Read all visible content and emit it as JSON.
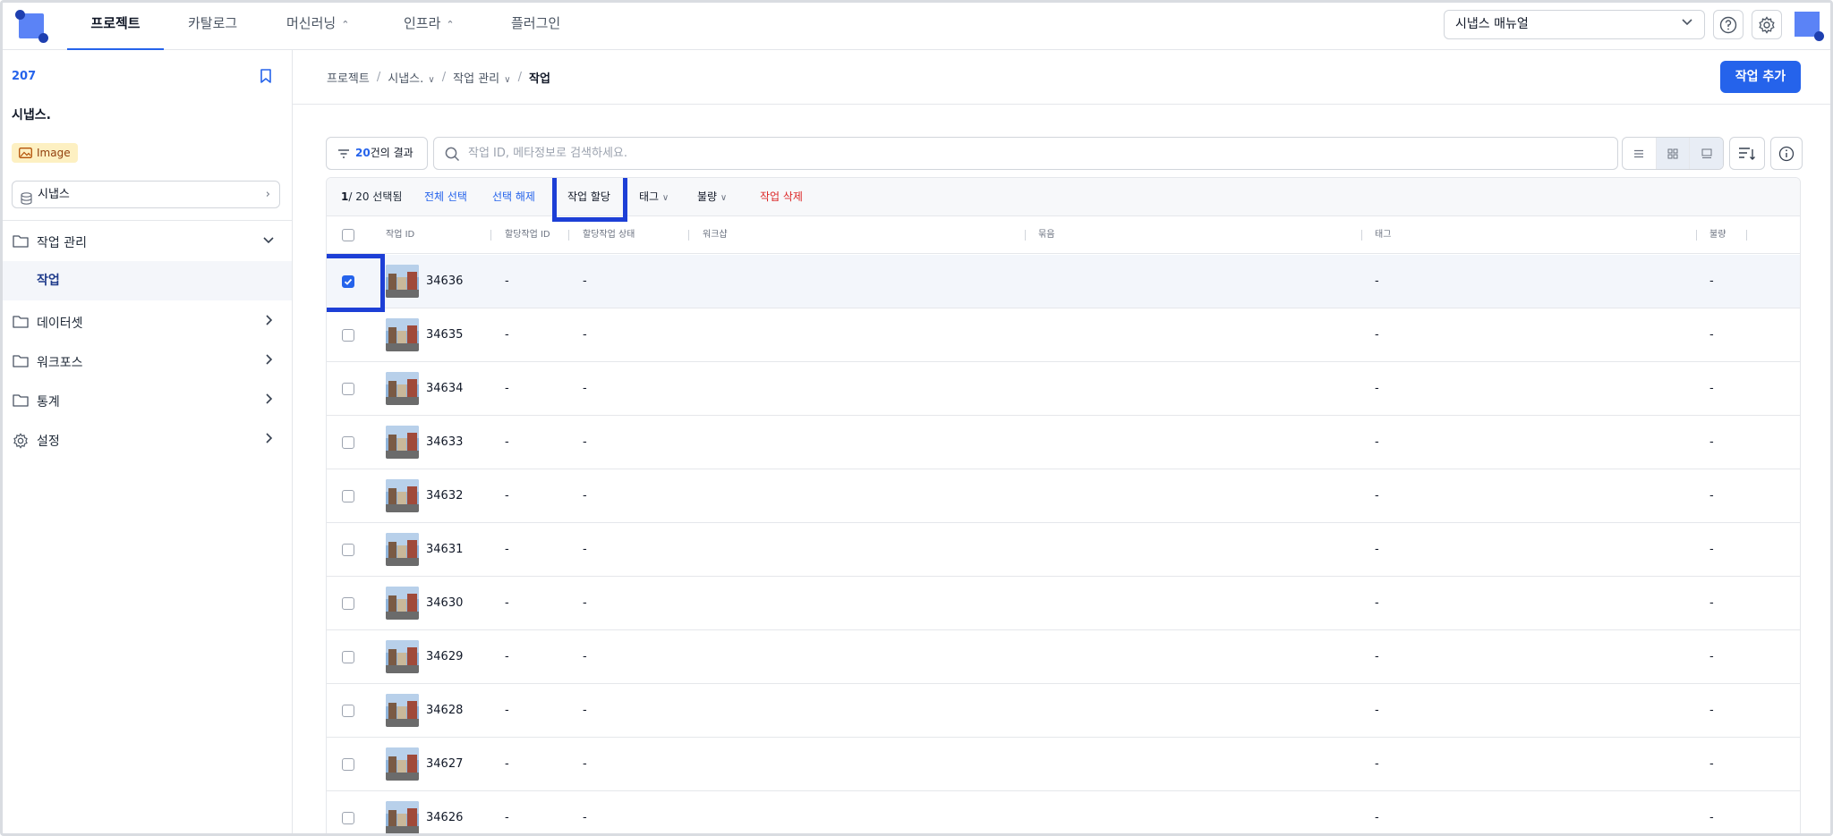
{
  "nav": {
    "tabs": [
      {
        "label": "프로젝트",
        "active": true
      },
      {
        "label": "카탈로그"
      },
      {
        "label": "머신러닝",
        "dropdown": true
      },
      {
        "label": "인프라",
        "dropdown": true
      },
      {
        "label": "플러그인"
      }
    ],
    "manual_select": "시냅스 매뉴얼"
  },
  "sidebar": {
    "project_id": "207",
    "project_name": "시냅스.",
    "badge": "Image",
    "dataset": "시냅스",
    "menu": [
      {
        "label": "작업 관리",
        "icon": "folder-icon",
        "expanded": true
      },
      {
        "label": "데이터셋",
        "icon": "folder-icon"
      },
      {
        "label": "워크포스",
        "icon": "folder-icon"
      },
      {
        "label": "통계",
        "icon": "folder-icon"
      },
      {
        "label": "설정",
        "icon": "gear-icon"
      }
    ],
    "submenu_active": "작업"
  },
  "breadcrumb": {
    "items": [
      "프로젝트",
      "시냅스.",
      "작업 관리",
      "작업"
    ]
  },
  "add_button": "작업 추가",
  "filter": {
    "count": "20",
    "suffix": "건의 결과"
  },
  "search": {
    "placeholder": "작업 ID, 메타정보로 검색하세요."
  },
  "actionbar": {
    "selected": "1",
    "total": "/ 20 선택됨",
    "select_all": "전체 선택",
    "deselect": "선택 해제",
    "assign": "작업 할당",
    "tag": "태그",
    "defect": "불량",
    "delete": "작업 삭제"
  },
  "columns": [
    "작업 ID",
    "할당작업 ID",
    "할당작업 상태",
    "워크샵",
    "묶음",
    "태그",
    "불량"
  ],
  "rows": [
    {
      "id": "34636",
      "assign_id": "-",
      "assign_status": "-",
      "tag": "-",
      "defect": "-",
      "checked": true
    },
    {
      "id": "34635",
      "assign_id": "-",
      "assign_status": "-",
      "tag": "-",
      "defect": "-"
    },
    {
      "id": "34634",
      "assign_id": "-",
      "assign_status": "-",
      "tag": "-",
      "defect": "-"
    },
    {
      "id": "34633",
      "assign_id": "-",
      "assign_status": "-",
      "tag": "-",
      "defect": "-"
    },
    {
      "id": "34632",
      "assign_id": "-",
      "assign_status": "-",
      "tag": "-",
      "defect": "-"
    },
    {
      "id": "34631",
      "assign_id": "-",
      "assign_status": "-",
      "tag": "-",
      "defect": "-"
    },
    {
      "id": "34630",
      "assign_id": "-",
      "assign_status": "-",
      "tag": "-",
      "defect": "-"
    },
    {
      "id": "34629",
      "assign_id": "-",
      "assign_status": "-",
      "tag": "-",
      "defect": "-"
    },
    {
      "id": "34628",
      "assign_id": "-",
      "assign_status": "-",
      "tag": "-",
      "defect": "-"
    },
    {
      "id": "34627",
      "assign_id": "-",
      "assign_status": "-",
      "tag": "-",
      "defect": "-"
    },
    {
      "id": "34626",
      "assign_id": "-",
      "assign_status": "-",
      "tag": "-",
      "defect": "-"
    }
  ],
  "colors": {
    "accent": "#2563eb",
    "highlight": "#1d3fd6",
    "danger": "#dc2626"
  }
}
